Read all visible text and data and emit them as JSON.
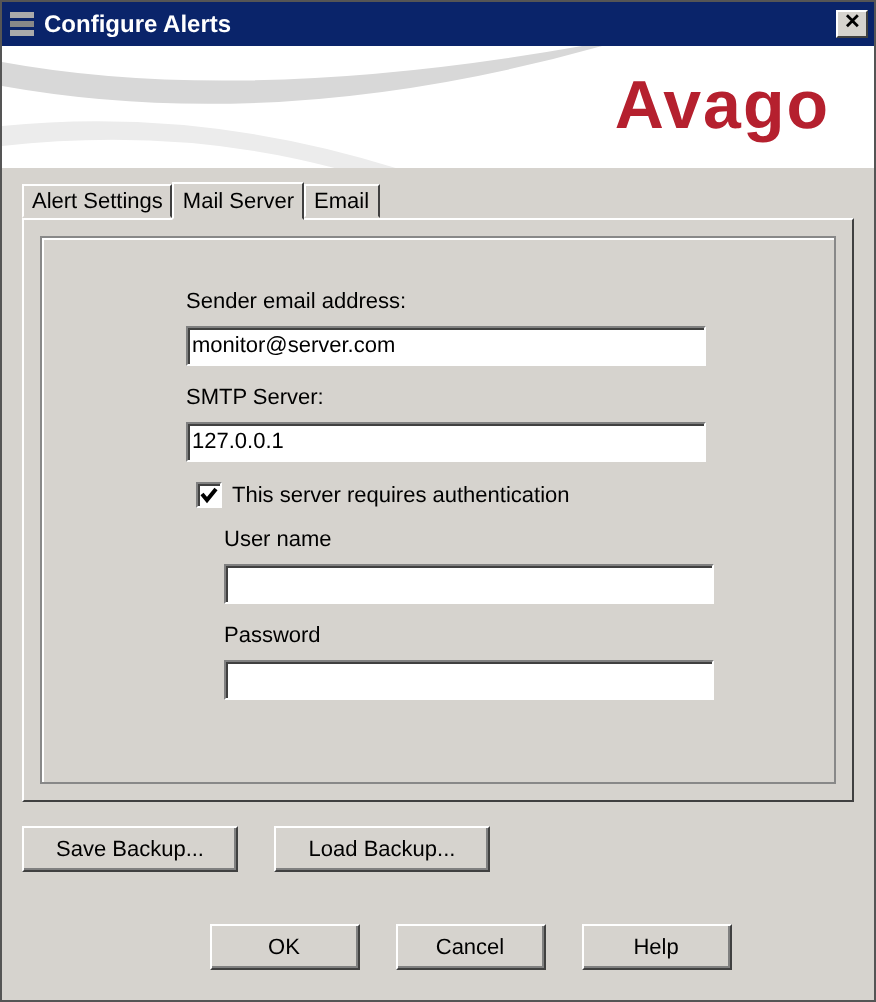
{
  "window": {
    "title": "Configure Alerts",
    "close": "✕"
  },
  "banner": {
    "logo": "Avago"
  },
  "tabs": [
    {
      "label": "Alert Settings",
      "selected": false
    },
    {
      "label": "Mail Server",
      "selected": true
    },
    {
      "label": "Email",
      "selected": false
    }
  ],
  "form": {
    "sender_label": "Sender email address:",
    "sender_value": "monitor@server.com",
    "smtp_label": "SMTP Server:",
    "smtp_value": "127.0.0.1",
    "auth": {
      "label": "This server requires authentication",
      "checked": true
    },
    "username_label": "User name",
    "password_label": "Password"
  },
  "backup_buttons": [
    "Save Backup...",
    "Load Backup..."
  ],
  "buttons": [
    "OK",
    "Cancel",
    "Help"
  ]
}
